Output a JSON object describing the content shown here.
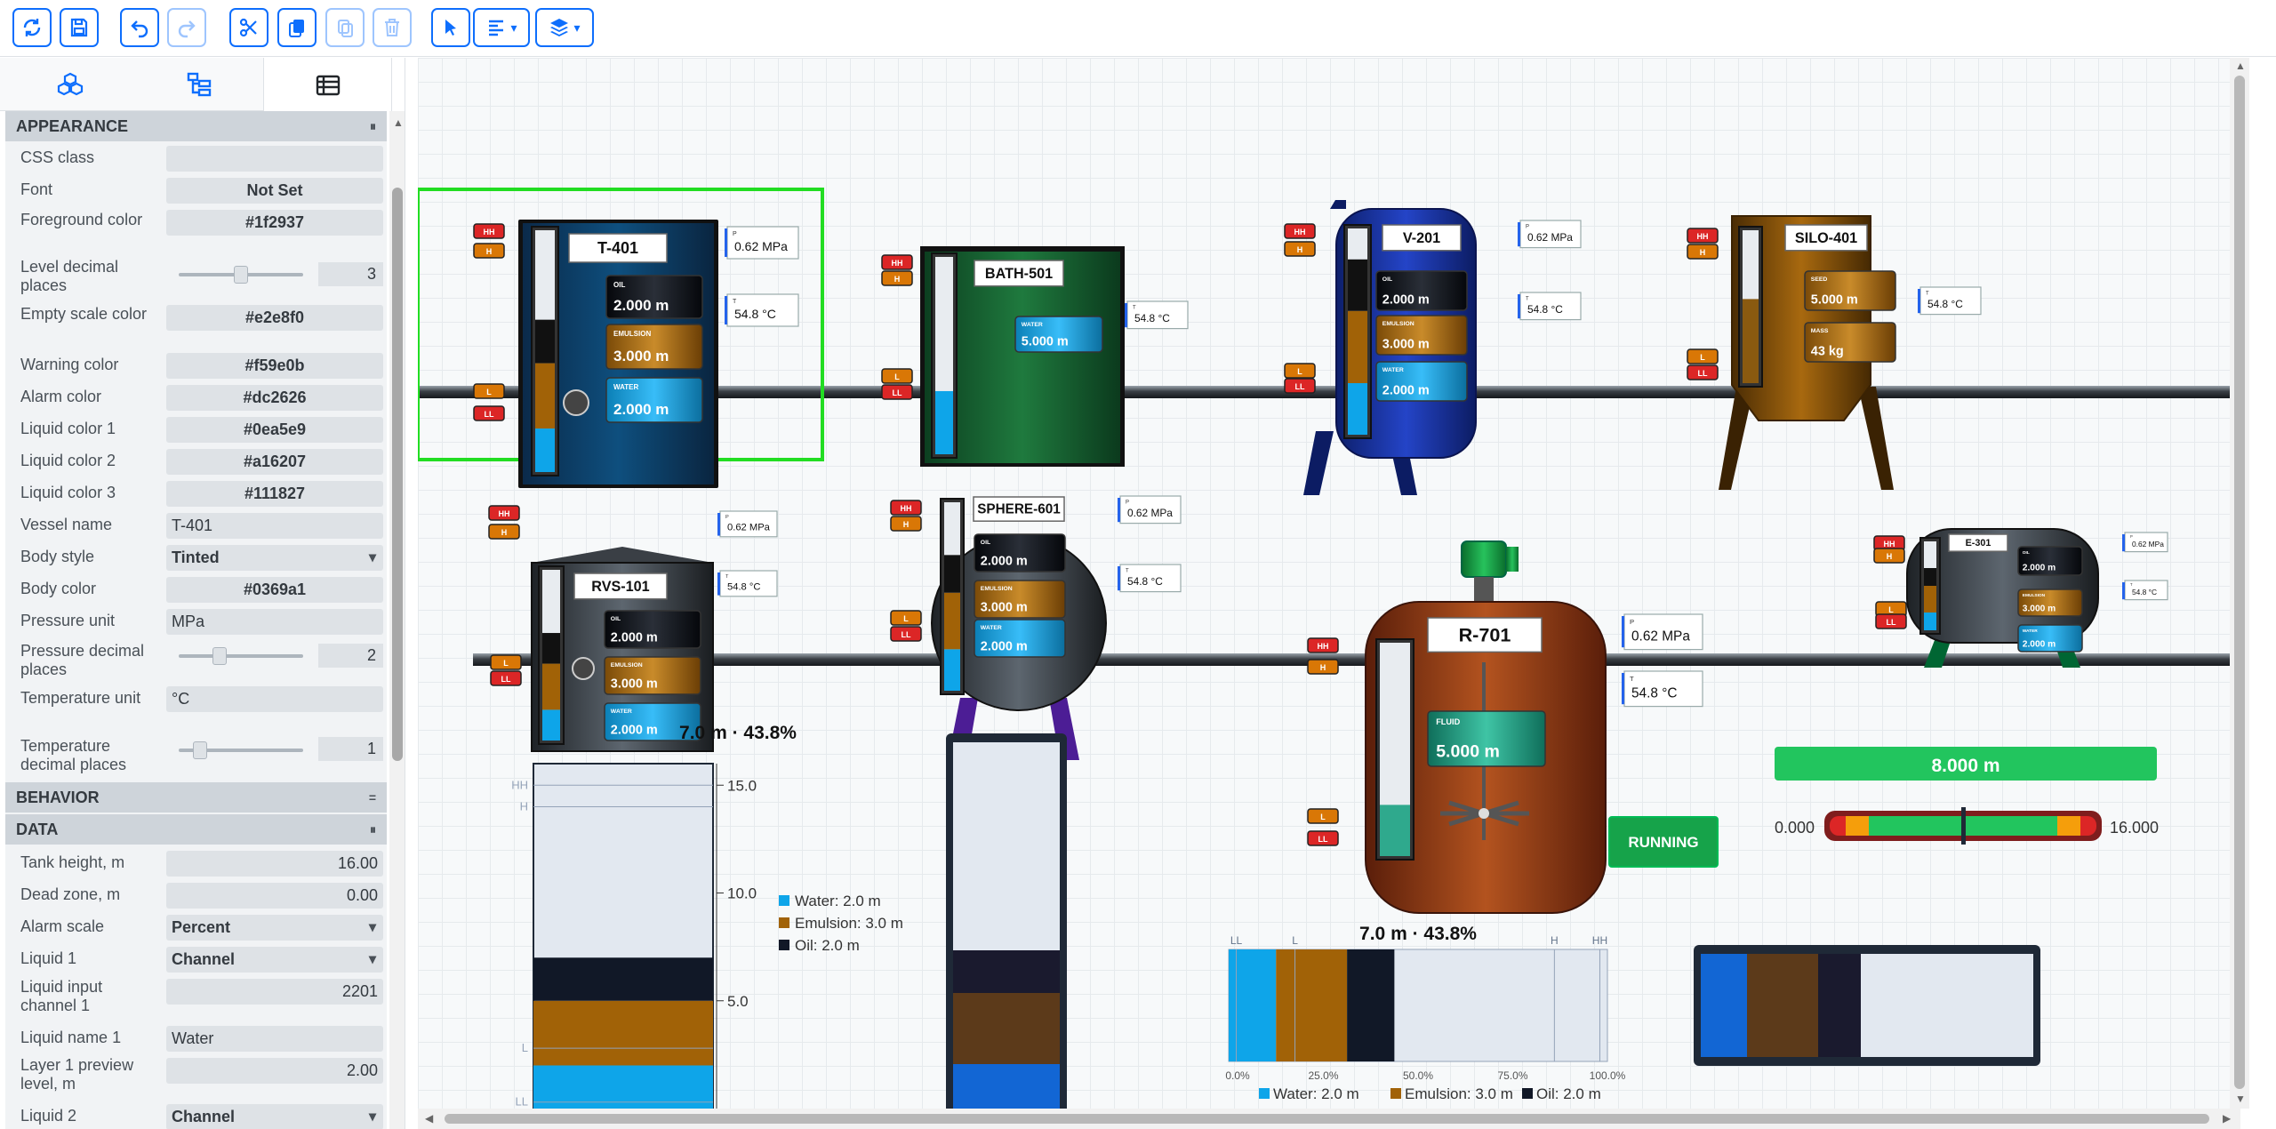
{
  "toolbar": {
    "buttons": [
      {
        "name": "refresh-button",
        "icon": "refresh-icon"
      },
      {
        "name": "save-button",
        "icon": "save-icon"
      },
      {
        "name": "undo-button",
        "icon": "undo-icon"
      },
      {
        "name": "redo-button",
        "icon": "redo-icon"
      },
      {
        "name": "cut-button",
        "icon": "scissors-icon"
      },
      {
        "name": "copy-button",
        "icon": "copy-icon"
      },
      {
        "name": "paste-button",
        "icon": "paste-icon"
      },
      {
        "name": "delete-button",
        "icon": "trash-icon"
      },
      {
        "name": "pointer-button",
        "icon": "pointer-icon"
      },
      {
        "name": "align-dropdown",
        "icon": "align-left-icon"
      },
      {
        "name": "layers-dropdown",
        "icon": "layers-icon"
      }
    ]
  },
  "sidebar": {
    "tabs": [
      {
        "name": "tab-components",
        "icon": "cubes-icon"
      },
      {
        "name": "tab-tree",
        "icon": "tree-icon"
      },
      {
        "name": "tab-properties",
        "icon": "table-icon",
        "active": true
      }
    ],
    "sections": {
      "appearance": "APPEARANCE",
      "behavior": "BEHAVIOR",
      "data": "DATA"
    },
    "appearance": {
      "css_class": {
        "label": "CSS class",
        "value": ""
      },
      "font": {
        "label": "Font",
        "value": "Not Set"
      },
      "foreground_color": {
        "label": "Foreground color",
        "value": "#1f2937"
      },
      "level_decimal_places": {
        "label": "Level decimal places",
        "value": "3",
        "slider": 0.5
      },
      "empty_scale_color": {
        "label": "Empty scale color",
        "value": "#e2e8f0"
      },
      "warning_color": {
        "label": "Warning color",
        "value": "#f59e0b"
      },
      "alarm_color": {
        "label": "Alarm color",
        "value": "#dc2626"
      },
      "liquid_color_1": {
        "label": "Liquid color 1",
        "value": "#0ea5e9"
      },
      "liquid_color_2": {
        "label": "Liquid color 2",
        "value": "#a16207"
      },
      "liquid_color_3": {
        "label": "Liquid color 3",
        "value": "#111827"
      },
      "vessel_name": {
        "label": "Vessel name",
        "value": "T-401"
      },
      "body_style": {
        "label": "Body style",
        "value": "Tinted"
      },
      "body_color": {
        "label": "Body color",
        "value": "#0369a1"
      },
      "pressure_unit": {
        "label": "Pressure unit",
        "value": "MPa"
      },
      "pressure_decimal_places": {
        "label": "Pressure decimal places",
        "value": "2",
        "slider": 0.33
      },
      "temperature_unit": {
        "label": "Temperature unit",
        "value": "°C"
      },
      "temperature_decimal_places": {
        "label": "Temperature decimal places",
        "value": "1",
        "slider": 0.17
      }
    },
    "data": {
      "tank_height": {
        "label": "Tank height, m",
        "value": "16.00"
      },
      "dead_zone": {
        "label": "Dead zone, m",
        "value": "0.00"
      },
      "alarm_scale": {
        "label": "Alarm scale",
        "value": "Percent"
      },
      "liquid_1": {
        "label": "Liquid 1",
        "value": "Channel"
      },
      "liquid_input_channel_1": {
        "label": "Liquid input channel 1",
        "value": "2201"
      },
      "liquid_name_1": {
        "label": "Liquid name 1",
        "value": "Water"
      },
      "layer_1_preview_level": {
        "label": "Layer 1 preview level, m",
        "value": "2.00"
      },
      "liquid_2": {
        "label": "Liquid 2",
        "value": "Channel"
      }
    }
  },
  "canvas": {
    "tanks": [
      {
        "id": "T-401",
        "pressure": "0.62 MPa",
        "temperature": "54.8 °C",
        "layers": [
          {
            "name": "OIL",
            "value": "2.000 m"
          },
          {
            "name": "EMULSION",
            "value": "3.000 m"
          },
          {
            "name": "WATER",
            "value": "2.000 m"
          }
        ],
        "alarms": [
          "HH",
          "H",
          "L",
          "LL"
        ]
      },
      {
        "id": "BATH-501",
        "temperature": "54.8 °C",
        "layers": [
          {
            "name": "WATER",
            "value": "5.000 m"
          }
        ],
        "alarms": [
          "HH",
          "H",
          "L",
          "LL"
        ]
      },
      {
        "id": "V-201",
        "pressure": "0.62 MPa",
        "temperature": "54.8 °C",
        "layers": [
          {
            "name": "OIL",
            "value": "2.000 m"
          },
          {
            "name": "EMULSION",
            "value": "3.000 m"
          },
          {
            "name": "WATER",
            "value": "2.000 m"
          }
        ],
        "alarms": [
          "HH",
          "H",
          "L",
          "LL"
        ]
      },
      {
        "id": "SILO-401",
        "temperature": "54.8 °C",
        "layers": [
          {
            "name": "SEED",
            "value": "5.000 m"
          },
          {
            "name": "MASS",
            "value": "43 kg"
          }
        ],
        "alarms": [
          "HH",
          "H",
          "L",
          "LL"
        ]
      },
      {
        "id": "RVS-101",
        "pressure": "0.62 MPa",
        "temperature": "54.8 °C",
        "layers": [
          {
            "name": "OIL",
            "value": "2.000 m"
          },
          {
            "name": "EMULSION",
            "value": "3.000 m"
          },
          {
            "name": "WATER",
            "value": "2.000 m"
          }
        ],
        "alarms": [
          "HH",
          "H",
          "L",
          "LL"
        ]
      },
      {
        "id": "SPHERE-601",
        "pressure": "0.62 MPa",
        "temperature": "54.8 °C",
        "layers": [
          {
            "name": "OIL",
            "value": "2.000 m"
          },
          {
            "name": "EMULSION",
            "value": "3.000 m"
          },
          {
            "name": "WATER",
            "value": "2.000 m"
          }
        ],
        "alarms": [
          "HH",
          "H",
          "L",
          "LL"
        ]
      },
      {
        "id": "R-701",
        "pressure": "0.62 MPa",
        "temperature": "54.8 °C",
        "layers": [
          {
            "name": "FLUID",
            "value": "5.000 m"
          }
        ],
        "alarms": [
          "HH",
          "H",
          "L",
          "LL"
        ],
        "status": "RUNNING"
      },
      {
        "id": "E-301",
        "pressure": "0.62 MPa",
        "temperature": "54.8 °C",
        "layers": [
          {
            "name": "OIL",
            "value": "2.000 m"
          },
          {
            "name": "EMULSION",
            "value": "3.000 m"
          },
          {
            "name": "WATER",
            "value": "2.000 m"
          }
        ],
        "alarms": [
          "HH",
          "H",
          "L",
          "LL"
        ]
      }
    ],
    "level_chart": {
      "title": "7.0 m · 43.8%",
      "ticks": [
        "15.0",
        "10.0",
        "5.0"
      ],
      "marks": [
        "HH",
        "H",
        "L",
        "LL"
      ],
      "legend": [
        "Water: 2.0 m",
        "Emulsion: 3.0 m",
        "Oil: 2.0 m"
      ]
    },
    "bar_chart": {
      "title": "7.0 m · 43.8%",
      "marks": [
        "LL",
        "L",
        "H",
        "HH"
      ],
      "ticks": [
        "0.0%",
        "25.0%",
        "50.0%",
        "75.0%",
        "100.0%"
      ],
      "legend": [
        "Water: 2.0 m",
        "Emulsion: 3.0 m",
        "Oil: 2.0 m"
      ]
    },
    "gauge": {
      "value": "8.000 m",
      "min": "0.000",
      "max": "16.000"
    },
    "colors": {
      "water": "#0ea5e9",
      "emulsion": "#a16207",
      "oil": "#111827",
      "empty": "#e2e8f0",
      "warning": "#f59e0b",
      "alarm": "#dc2626",
      "selection": "#22dd22",
      "running": "#16a34a"
    }
  }
}
